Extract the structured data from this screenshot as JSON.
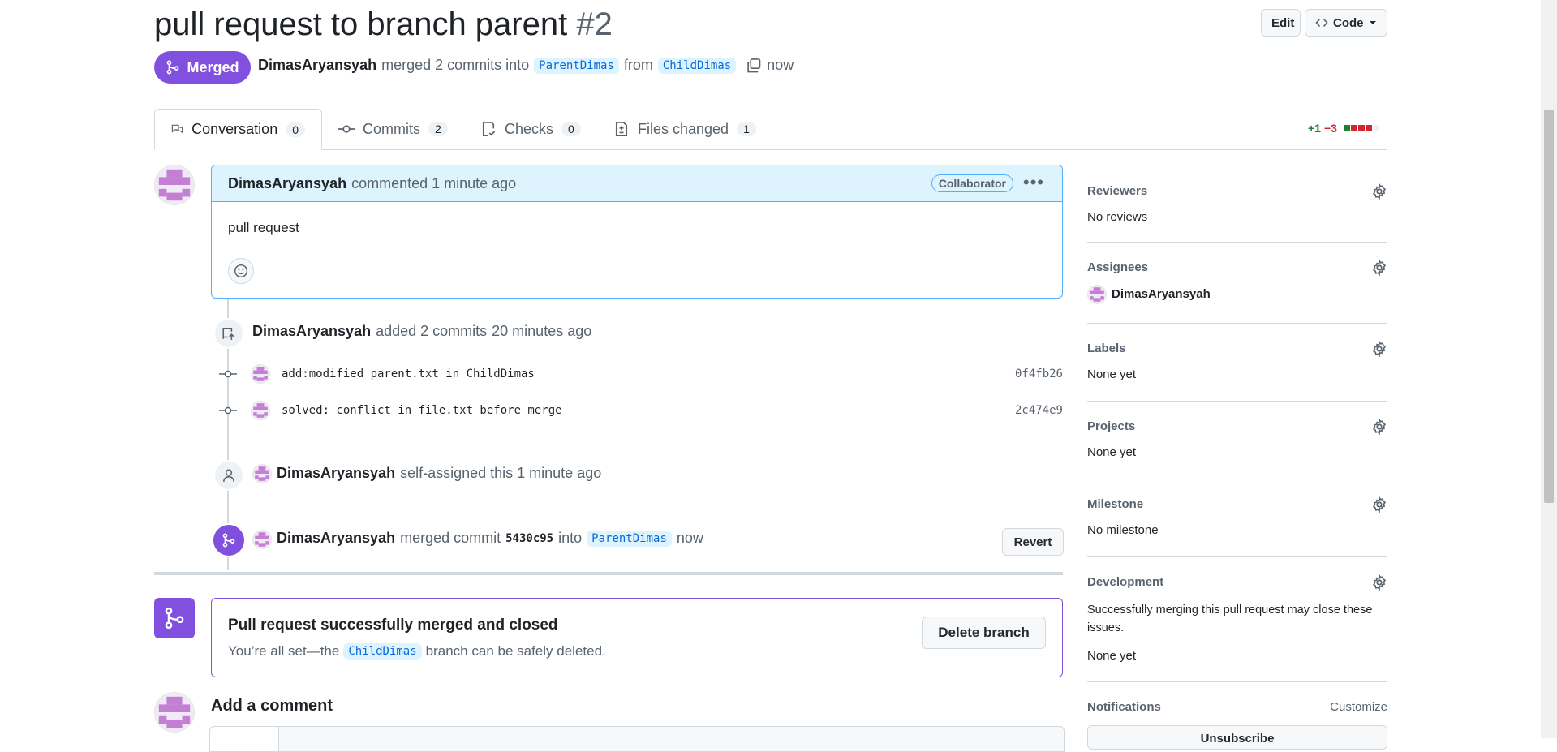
{
  "pr": {
    "title": "pull request to branch parent",
    "number": "#2",
    "state": "Merged",
    "author": "DimasAryansyah",
    "merge_text": "merged 2 commits into",
    "base_branch": "ParentDimas",
    "from_word": "from",
    "head_branch": "ChildDimas",
    "time": "now"
  },
  "header_buttons": {
    "edit": "Edit",
    "code": "Code"
  },
  "tabs": [
    {
      "label": "Conversation",
      "count": "0"
    },
    {
      "label": "Commits",
      "count": "2"
    },
    {
      "label": "Checks",
      "count": "0"
    },
    {
      "label": "Files changed",
      "count": "1"
    }
  ],
  "diffstat": {
    "additions": "+1",
    "deletions": "−3"
  },
  "comment": {
    "author": "DimasAryansyah",
    "action": "commented 1 minute ago",
    "badge": "Collaborator",
    "body": "pull request"
  },
  "timeline": {
    "commits_event": {
      "author": "DimasAryansyah",
      "action": "added 2 commits",
      "time": "20 minutes ago"
    },
    "commits": [
      {
        "message": "add:modified parent.txt in ChildDimas",
        "sha": "0f4fb26"
      },
      {
        "message": "solved: conflict in file.txt before merge",
        "sha": "2c474e9"
      }
    ],
    "assign_event": {
      "author": "DimasAryansyah",
      "action": "self-assigned this 1 minute ago"
    },
    "merge_event": {
      "author": "DimasAryansyah",
      "action": "merged commit",
      "sha": "5430c95",
      "into": "into",
      "branch": "ParentDimas",
      "time": "now",
      "revert": "Revert"
    }
  },
  "merged_box": {
    "title": "Pull request successfully merged and closed",
    "sub_prefix": "You’re all set—the",
    "branch": "ChildDimas",
    "sub_suffix": "branch can be safely deleted.",
    "delete_button": "Delete branch"
  },
  "add_comment": {
    "title": "Add a comment"
  },
  "sidebar": {
    "reviewers": {
      "heading": "Reviewers",
      "value": "No reviews"
    },
    "assignees": {
      "heading": "Assignees",
      "value": "DimasAryansyah"
    },
    "labels": {
      "heading": "Labels",
      "value": "None yet"
    },
    "projects": {
      "heading": "Projects",
      "value": "None yet"
    },
    "milestone": {
      "heading": "Milestone",
      "value": "No milestone"
    },
    "development": {
      "heading": "Development",
      "description": "Successfully merging this pull request may close these issues.",
      "value": "None yet"
    },
    "notifications": {
      "heading": "Notifications",
      "customize": "Customize",
      "unsubscribe": "Unsubscribe"
    }
  },
  "colors": {
    "merged": "#8250df",
    "accent_blue": "#0969da",
    "comment_header": "#ddf4ff"
  }
}
